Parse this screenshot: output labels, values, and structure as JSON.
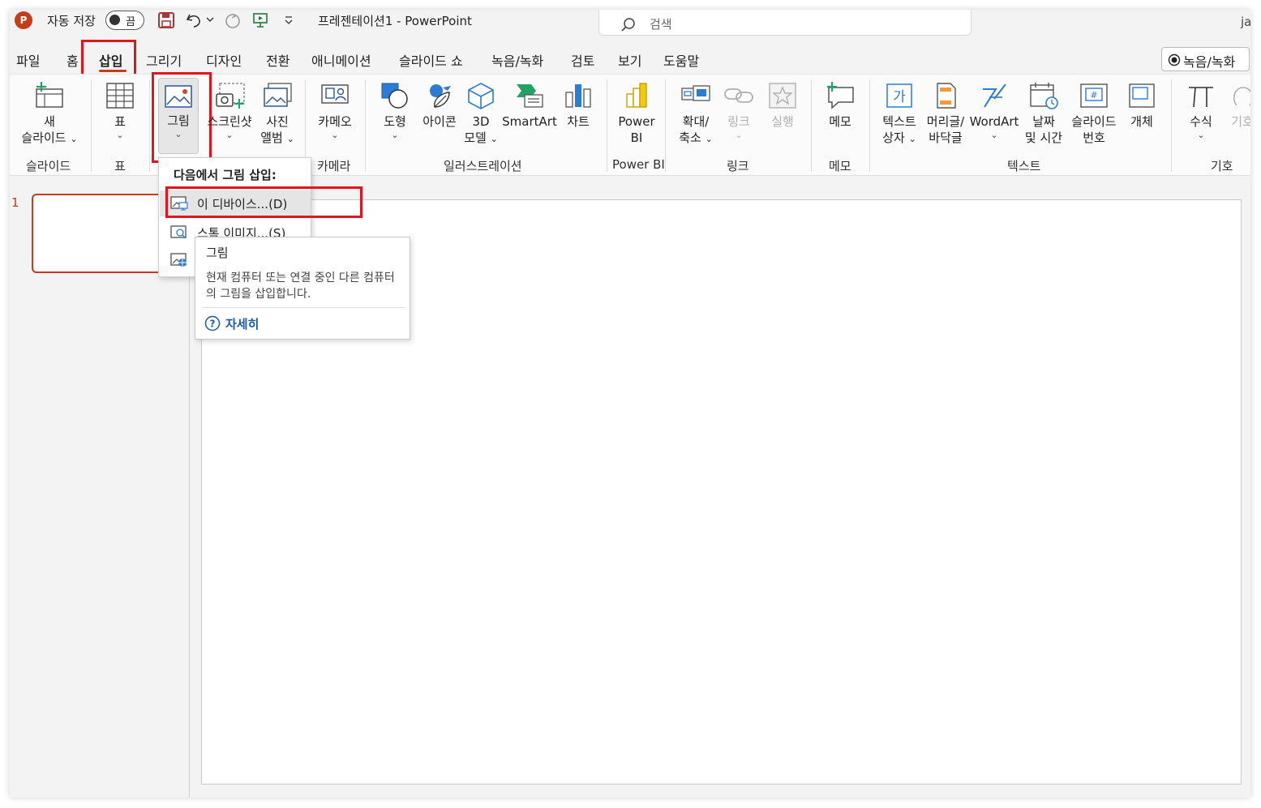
{
  "titlebar": {
    "app_badge": "P",
    "autosave_label": "자동 저장",
    "autosave_state": "끔",
    "doc_title": "프레젠테이션1  -  PowerPoint",
    "search_placeholder": "검색",
    "user_initials": "ja"
  },
  "tabs": [
    "파일",
    "홈",
    "삽입",
    "그리기",
    "디자인",
    "전환",
    "애니메이션",
    "슬라이드 쇼",
    "녹음/녹화",
    "검토",
    "보기",
    "도움말"
  ],
  "active_tab": "삽입",
  "record_button": "녹음/녹화",
  "ribbon": {
    "groups": [
      "슬라이드",
      "표",
      "카메라",
      "일러스트레이션",
      "Power BI",
      "링크",
      "메모",
      "텍스트",
      "기호"
    ],
    "buttons": {
      "new_slide": [
        "새",
        "슬라이드"
      ],
      "table": "표",
      "picture": "그림",
      "screenshot": "스크린샷",
      "photo_album": [
        "사진",
        "앨범"
      ],
      "cameo": "카메오",
      "shapes": "도형",
      "icons": "아이콘",
      "models_3d": [
        "3D",
        "모델"
      ],
      "smartart": "SmartArt",
      "chart": "차트",
      "power_bi": [
        "Power",
        "BI"
      ],
      "zoom": [
        "확대/",
        "축소"
      ],
      "link": "링크",
      "action": "실행",
      "comment": "메모",
      "textbox": [
        "텍스트",
        "상자"
      ],
      "header_footer": [
        "머리글/",
        "바닥글"
      ],
      "wordart": "WordArt",
      "date_time": [
        "날짜",
        "및 시간"
      ],
      "slide_number": [
        "슬라이드",
        "번호"
      ],
      "object": "개체",
      "equation": "수식",
      "symbol": "기호"
    }
  },
  "thumbnail_pane": {
    "slide_number": "1"
  },
  "dropdown": {
    "header": "다음에서 그림 삽입:",
    "items": [
      {
        "label": "이 디바이스...(D)",
        "icon": "picture-device-icon"
      },
      {
        "label": "스톡 이미지...(S)",
        "icon": "picture-search-icon"
      },
      {
        "label": "",
        "icon": "picture-online-icon"
      }
    ]
  },
  "tooltip": {
    "title": "그림",
    "description": "현재 컴퓨터 또는 연결 중인 다른 컴퓨터의 그림을 삽입합니다.",
    "more": "자세히"
  },
  "colors": {
    "accent": "#c43e1c",
    "highlight_box": "#e0161f",
    "link": "#1a5aa8"
  }
}
